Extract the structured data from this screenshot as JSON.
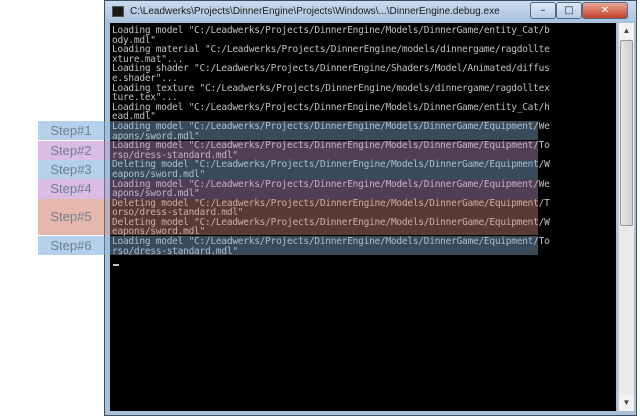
{
  "window": {
    "title": "C:\\Leadwerks\\Projects\\DinnerEngine\\Projects\\Windows\\...\\DinnerEngine.debug.exe",
    "buttons": {
      "minimize": "–",
      "maximize": "□",
      "close": "✕"
    }
  },
  "console": {
    "lines": [
      "Loading model \"C:/Leadwerks/Projects/DinnerEngine/Models/DinnerGame/entity_Cat/b",
      "ody.mdl\"",
      "Loading material \"C:/Leadwerks/Projects/DinnerEngine/models/dinnergame/ragdollte",
      "xture.mat\"...",
      "Loading shader \"C:/Leadwerks/Projects/DinnerEngine/Shaders/Model/Animated/diffus",
      "e.shader\"...",
      "Loading texture \"C:/Leadwerks/Projects/DinnerEngine/models/dinnergame/ragdolltex",
      "ture.tex\"...",
      "Loading model \"C:/Leadwerks/Projects/DinnerEngine/Models/DinnerGame/entity_Cat/h",
      "ead.mdl\"",
      "Loading model \"C:/Leadwerks/Projects/DinnerEngine/Models/DinnerGame/Equipment/We",
      "apons/sword.mdl\"",
      "Loading model \"C:/Leadwerks/Projects/DinnerEngine/Models/DinnerGame/Equipment/To",
      "rso/dress-standard.mdl\"",
      "Deleting model \"C:/Leadwerks/Projects/DinnerEngine/Models/DinnerGame/Equipment/W",
      "eapons/sword.mdl\"",
      "Loading model \"C:/Leadwerks/Projects/DinnerEngine/Models/DinnerGame/Equipment/We",
      "apons/sword.mdl\"",
      "Deleting model \"C:/Leadwerks/Projects/DinnerEngine/Models/DinnerGame/Equipment/T",
      "orso/dress-standard.mdl\"",
      "Deleting model \"C:/Leadwerks/Projects/DinnerEngine/Models/DinnerGame/Equipment/W",
      "eapons/sword.mdl\"",
      "Loading model \"C:/Leadwerks/Projects/DinnerEngine/Models/DinnerGame/Equipment/To",
      "rso/dress-standard.mdl\""
    ]
  },
  "steps": [
    {
      "label": "Step#1",
      "color": "#8fb8e0"
    },
    {
      "label": "Step#2",
      "color": "#c79ad8"
    },
    {
      "label": "Step#3",
      "color": "#8fb8e0"
    },
    {
      "label": "Step#4",
      "color": "#c79ad8"
    },
    {
      "label": "Step#5",
      "color": "#d99383"
    },
    {
      "label": "Step#6",
      "color": "#8fb8e0"
    }
  ],
  "colors": {
    "console_bg": "#000000",
    "console_text": "#c0c0c0",
    "titlebar": "#b3cbe3",
    "close_button": "#c7432c"
  }
}
